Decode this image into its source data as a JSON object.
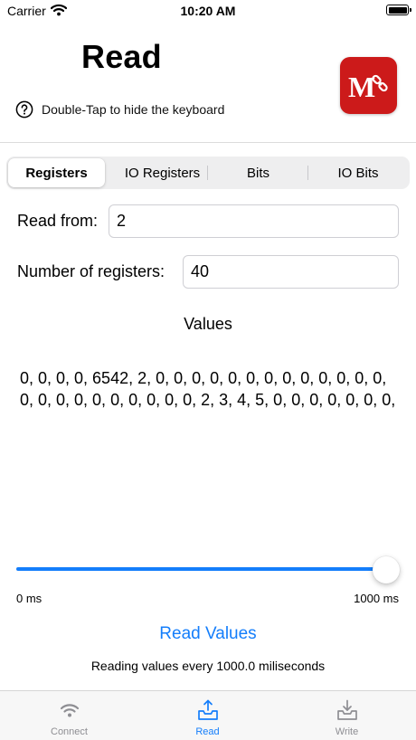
{
  "status_bar": {
    "carrier": "Carrier",
    "time": "10:20 AM",
    "icons": [
      "wifi-icon",
      "battery-icon"
    ]
  },
  "header": {
    "title": "Read",
    "hint": "Double-Tap to hide the keyboard",
    "hint_icon": "help-circle-icon",
    "logo_icon": "modbus-logo-icon"
  },
  "segments": {
    "items": [
      "Registers",
      "IO Registers",
      "Bits",
      "IO Bits"
    ],
    "selected": "Registers"
  },
  "form": {
    "read_from_label": "Read from:",
    "read_from_value": "2",
    "count_label": "Number of registers:",
    "count_value": "40"
  },
  "values": {
    "title": "Values",
    "text": "0, 0, 0, 0, 6542, 2, 0, 0, 0, 0, 0, 0, 0, 0, 0, 0, 0, 0, 0, 0, 0, 0, 0, 0, 0, 0, 0, 0, 0, 2, 3, 4, 5, 0, 0, 0, 0, 0, 0, 0,"
  },
  "slider": {
    "min_label": "0 ms",
    "max_label": "1000 ms",
    "value_fraction": 1.0
  },
  "actions": {
    "read_button": "Read Values",
    "status": "Reading values every 1000.0 miliseconds"
  },
  "tab_bar": {
    "tabs": [
      {
        "label": "Connect",
        "icon": "wifi-icon"
      },
      {
        "label": "Read",
        "icon": "tray-upload-icon"
      },
      {
        "label": "Write",
        "icon": "tray-download-icon"
      }
    ],
    "active": "Read"
  },
  "colors": {
    "accent": "#147efb",
    "logo_red": "#cc1a1a",
    "inactive_tab": "#8e8e93"
  }
}
